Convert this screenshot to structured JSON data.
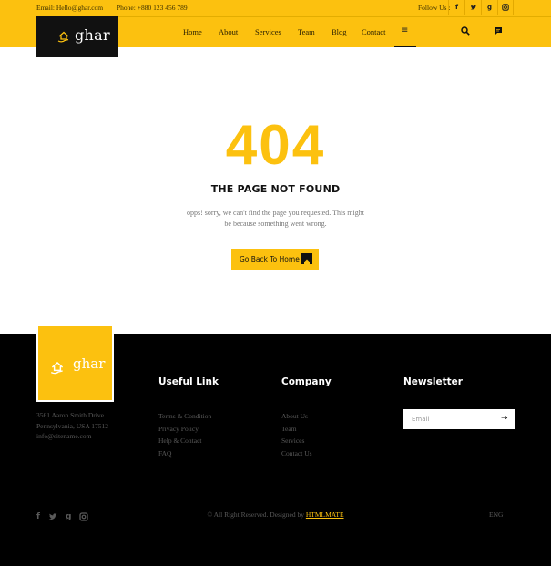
{
  "topbar": {
    "email": "Email: Hello@ghar.com",
    "phone": "Phone: +880 123 456 789",
    "follow_label": "Follow Us :",
    "social": [
      "f",
      "t",
      "g",
      "i"
    ]
  },
  "brand": {
    "name": "ghar"
  },
  "nav": {
    "items": [
      "Home",
      "About",
      "Services",
      "Team",
      "Blog",
      "Contact"
    ],
    "menu_icon": "hamburger-icon",
    "search_icon": "search-icon",
    "chat_icon": "chat-icon"
  },
  "error": {
    "code": "404",
    "title": "THE PAGE NOT FOUND",
    "desc_line1": "opps! sorry, we can't find the page you requested. This might",
    "desc_line2": "be because something went wrong.",
    "button_label": "Go Back To Home"
  },
  "footer": {
    "address": [
      "3561 Aaron Smith Drive",
      "Pennsylvania, USA 17512",
      "info@sitename.com"
    ],
    "useful_title": "Useful Link",
    "useful_links": [
      "Terms & Condition",
      "Privacy Policy",
      "Help & Contact",
      "FAQ"
    ],
    "company_title": "Company",
    "company_links": [
      "About Us",
      "Team",
      "Services",
      "Contact Us"
    ],
    "newsletter_title": "Newsletter",
    "email_placeholder": "Email",
    "copyright_prefix": "© All Right Reserved. Designed by",
    "copyright_brand": "HTMLMATE",
    "language": "ENG",
    "social": [
      "f",
      "t",
      "g",
      "i"
    ]
  },
  "colors": {
    "accent": "#fcc10f",
    "dark": "#111111",
    "footer_bg": "#000000"
  }
}
